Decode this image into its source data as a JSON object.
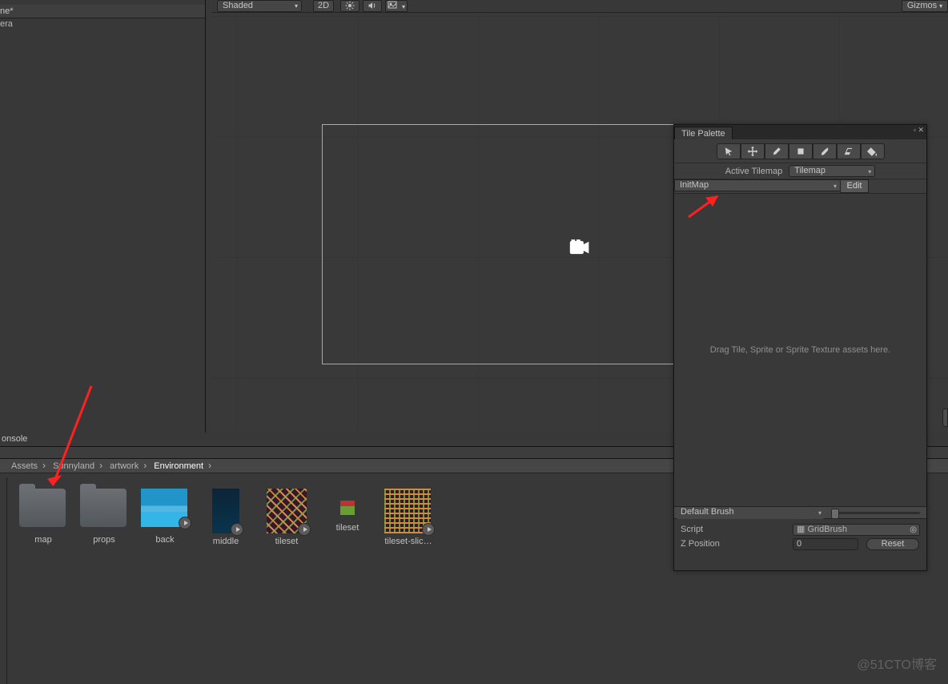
{
  "hierarchy": {
    "scene_label": "ne*",
    "camera_label": "era"
  },
  "scene_toolbar": {
    "shaded": "Shaded",
    "btn_2d": "2D",
    "gizmos": "Gizmos"
  },
  "project": {
    "console_tab": "onsole",
    "breadcrumb": [
      "Assets",
      "Sunnyland",
      "artwork",
      "Environment"
    ],
    "assets": [
      {
        "label": "map",
        "kind": "folder"
      },
      {
        "label": "props",
        "kind": "folder"
      },
      {
        "label": "back",
        "kind": "sky",
        "play": true
      },
      {
        "label": "middle",
        "kind": "dark",
        "play": true
      },
      {
        "label": "tileset",
        "kind": "tileset",
        "play": true
      },
      {
        "label": "tileset",
        "kind": "tileset-small"
      },
      {
        "label": "tileset-slic…",
        "kind": "tileset3",
        "play": true
      }
    ]
  },
  "palette": {
    "title": "Tile Palette",
    "active_tilemap_lbl": "Active Tilemap",
    "tilemap_dd": "Tilemap",
    "palette_dd": "InitMap",
    "edit_btn": "Edit",
    "drop_hint": "Drag Tile, Sprite or Sprite Texture assets here.",
    "brush_dd": "Default Brush",
    "script_lbl": "Script",
    "script_val": "GridBrush",
    "z_lbl": "Z Position",
    "z_val": "0",
    "reset": "Reset"
  },
  "watermark": "@51CTO博客"
}
